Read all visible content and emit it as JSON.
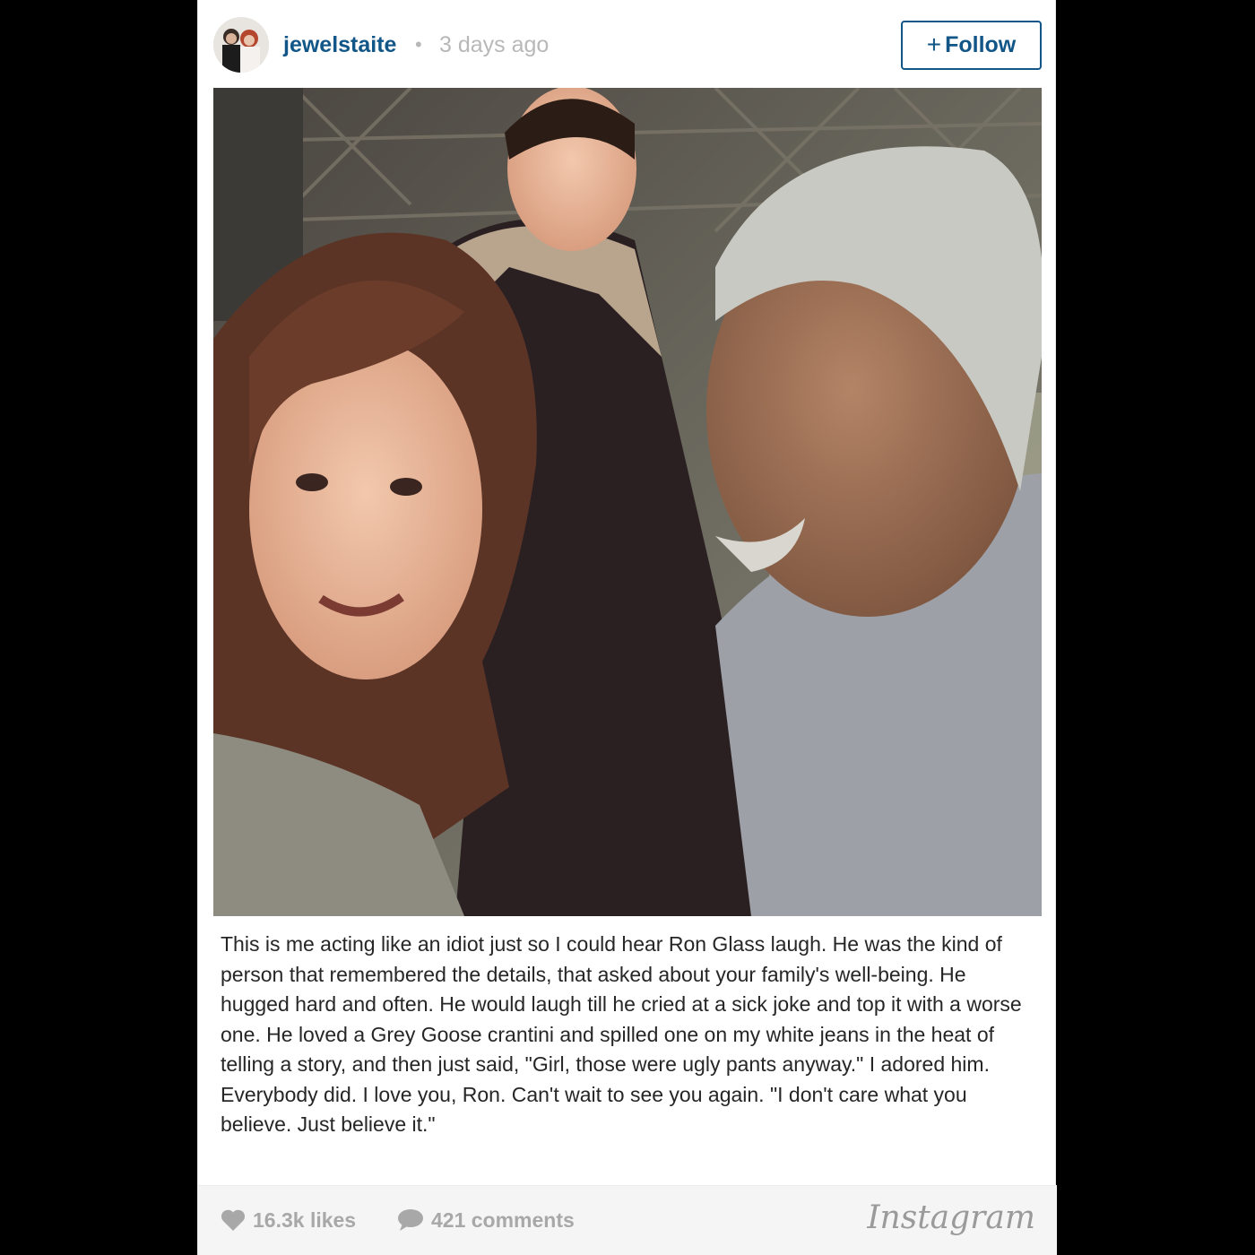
{
  "post": {
    "username": "jewelstaite",
    "separator": "•",
    "time": "3 days ago",
    "follow_label": "Follow",
    "follow_plus": "+",
    "caption": "This is me acting like an idiot just so I could hear Ron Glass laugh. He was the kind of person that remembered the details, that asked about your family's well-being. He hugged hard and often. He would laugh till he cried at a sick joke and top it with a worse one. He loved a Grey Goose crantini and spilled one on my white jeans in the heat of telling a story, and then just said, \"Girl, those were ugly pants anyway.\" I adored him. Everybody did. I love you, Ron. Can't wait to see you again. \"I don't care what you believe. Just believe it.\"",
    "likes": "16.3k likes",
    "comments": "421 comments",
    "brand": "Instagram"
  },
  "icons": {
    "like": "heart-icon",
    "comment": "speech-bubble-icon",
    "follow": "plus-icon"
  },
  "colors": {
    "link": "#125688",
    "muted": "#b8b8b8",
    "stat": "#a8a8a8",
    "footer_bg": "#f5f5f5"
  }
}
